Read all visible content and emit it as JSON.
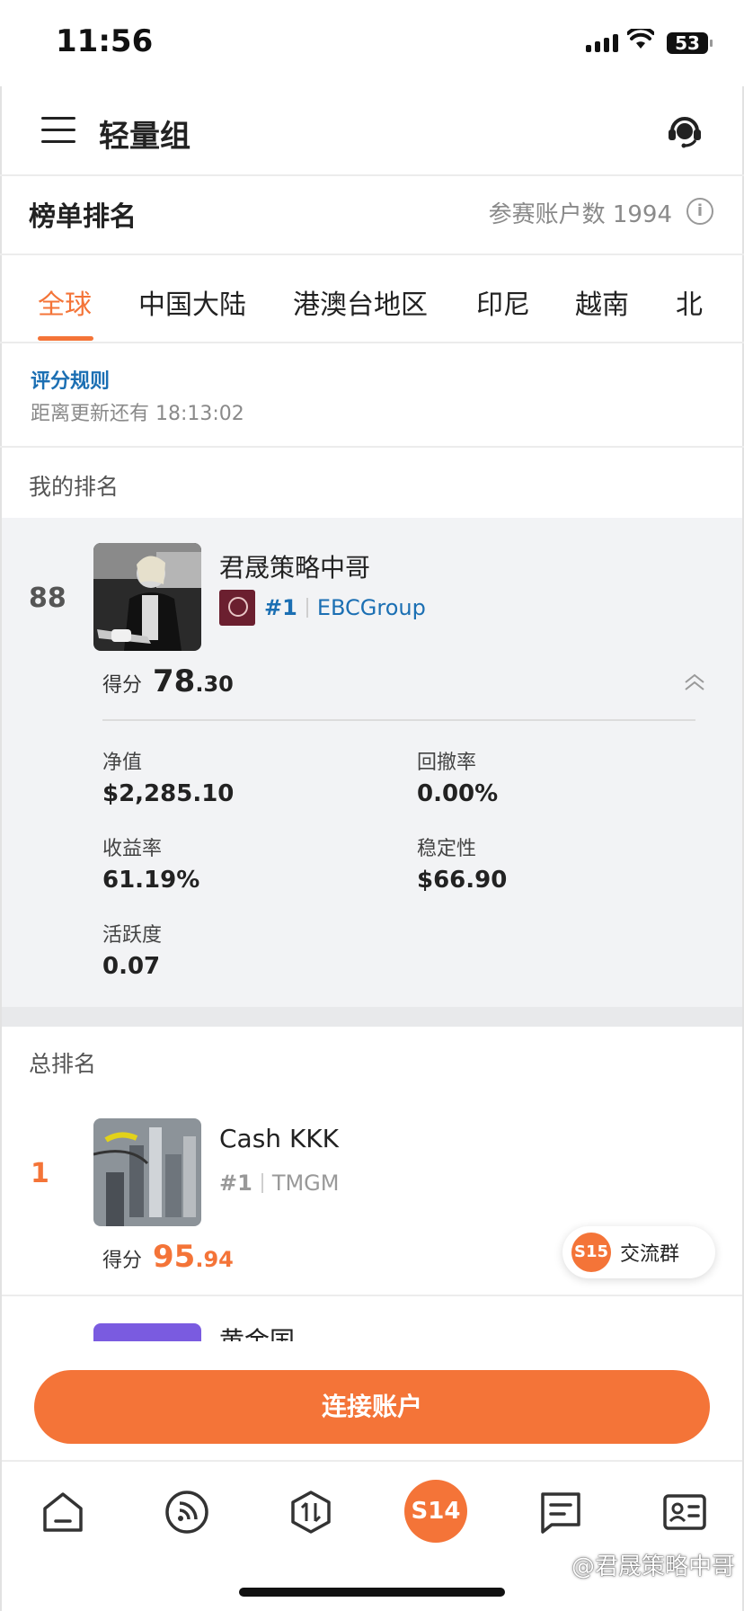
{
  "status": {
    "time": "11:56",
    "battery": "53"
  },
  "header": {
    "title": "轻量组"
  },
  "board": {
    "title": "榜单排名",
    "participants": "参赛账户数 1994",
    "info": "i"
  },
  "tabs": [
    "全球",
    "中国大陆",
    "港澳台地区",
    "印尼",
    "越南",
    "北"
  ],
  "active_tab": "全球",
  "rules": {
    "link": "评分规则",
    "countdown": "距离更新还有 18:13:02"
  },
  "my_rank": {
    "section_title": "我的排名",
    "rank": "88",
    "name": "君晟策略中哥",
    "badge_rank": "#1",
    "broker": "EBCGroup",
    "score_label": "得分",
    "score_int": "78",
    "score_dec": ".30",
    "stats": [
      {
        "label": "净值",
        "value": "$2,285.10"
      },
      {
        "label": "回撤率",
        "value": "0.00%"
      },
      {
        "label": "收益率",
        "value": "61.19%"
      },
      {
        "label": "稳定性",
        "value": "$66.90"
      },
      {
        "label": "活跃度",
        "value": "0.07"
      }
    ]
  },
  "overall": {
    "section_title": "总排名",
    "first": {
      "rank": "1",
      "name": "Cash KKK",
      "badge_rank": "#1",
      "broker": "TMGM",
      "score_label": "得分",
      "score_int": "95",
      "score_dec": ".94"
    },
    "second_peek_name": "黄金国"
  },
  "float_group": {
    "badge": "S15",
    "label": "交流群"
  },
  "connect_button": "连接账户",
  "tabbar": {
    "center": "S14"
  },
  "watermark": "@君晟策略中哥",
  "colors": {
    "accent": "#f47438",
    "link": "#1b6fb3",
    "broker_logo": "#6b1f2f"
  }
}
